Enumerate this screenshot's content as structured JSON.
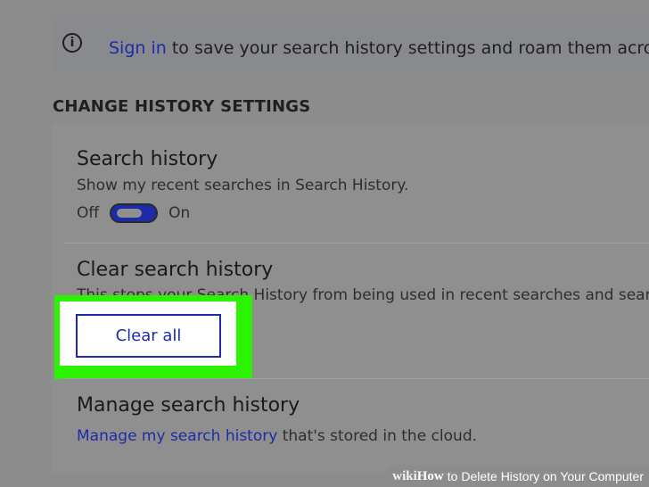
{
  "banner": {
    "sign_in_link": "Sign in",
    "message": " to save your search history settings and roam them across differe"
  },
  "section": {
    "header": "CHANGE HISTORY SETTINGS"
  },
  "search_history": {
    "title": "Search history",
    "description": "Show my recent searches in Search History.",
    "toggle_off_label": "Off",
    "toggle_on_label": "On",
    "toggle_state": "on"
  },
  "clear_history": {
    "title": "Clear search history",
    "description": "This stops your Search History from being used in recent searches and search",
    "button_label": "Clear all"
  },
  "manage_history": {
    "title": "Manage search history",
    "link": "Manage my search history",
    "suffix": " that's stored in the cloud."
  },
  "watermark": {
    "logo_wiki": "wiki",
    "logo_how": "How",
    "text": " to Delete History on Your Computer"
  },
  "colors": {
    "accent": "#1d2ba8",
    "highlight": "#2cf400",
    "background": "#8c8c8c"
  }
}
